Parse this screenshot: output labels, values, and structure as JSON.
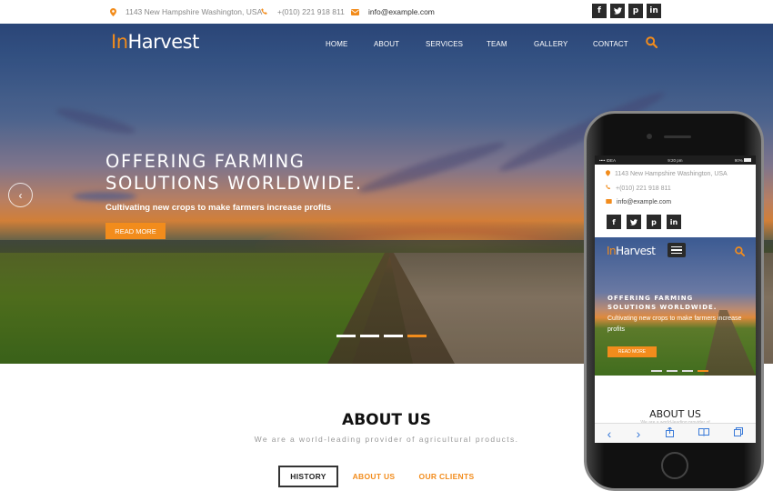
{
  "colors": {
    "accent": "#f28c1c",
    "dark": "#2a2a2a"
  },
  "topbar": {
    "address": "1143 New Hampshire Washington, USA",
    "phone": "+(010) 221 918 811",
    "email": "info@example.com",
    "social": [
      {
        "name": "facebook",
        "glyph": "f"
      },
      {
        "name": "twitter",
        "glyph": "t"
      },
      {
        "name": "pinterest",
        "glyph": "p"
      },
      {
        "name": "linkedin",
        "glyph": "in"
      }
    ]
  },
  "header": {
    "logo_accent": "In",
    "logo_rest": "Harvest",
    "nav": [
      "HOME",
      "ABOUT",
      "SERVICES",
      "TEAM",
      "GALLERY",
      "CONTACT"
    ]
  },
  "hero": {
    "headline_line1": "OFFERING FARMING",
    "headline_line2": "SOLUTIONS WORLDWIDE.",
    "subline": "Cultivating new crops to make farmers increase profits",
    "button": "READ MORE",
    "prev_glyph": "‹",
    "slides_total": 4,
    "active_slide": 4
  },
  "about": {
    "title": "ABOUT US",
    "subtitle": "We are a world-leading provider of agricultural products.",
    "tabs": [
      {
        "label": "HISTORY",
        "active": true
      },
      {
        "label": "ABOUT US",
        "active": false
      },
      {
        "label": "OUR CLIENTS",
        "active": false
      }
    ]
  },
  "phone": {
    "status_carrier": "•••• IDEA",
    "status_time": "9:20 pm",
    "status_battery": "90%",
    "address": "1143 New Hampshire Washington, USA",
    "phone": "+(010) 221 918 811",
    "email": "info@example.com",
    "logo_accent": "In",
    "logo_rest": "Harvest",
    "headline_line1": "OFFERING FARMING",
    "headline_line2": "SOLUTIONS WORLDWIDE.",
    "subline": "Cultivating new crops to make farmers increase profits",
    "button": "READ MORE",
    "about_title": "ABOUT US",
    "about_sub": "We are a world-leading provider of",
    "toolbar": {
      "back": "‹",
      "forward": "›"
    }
  }
}
